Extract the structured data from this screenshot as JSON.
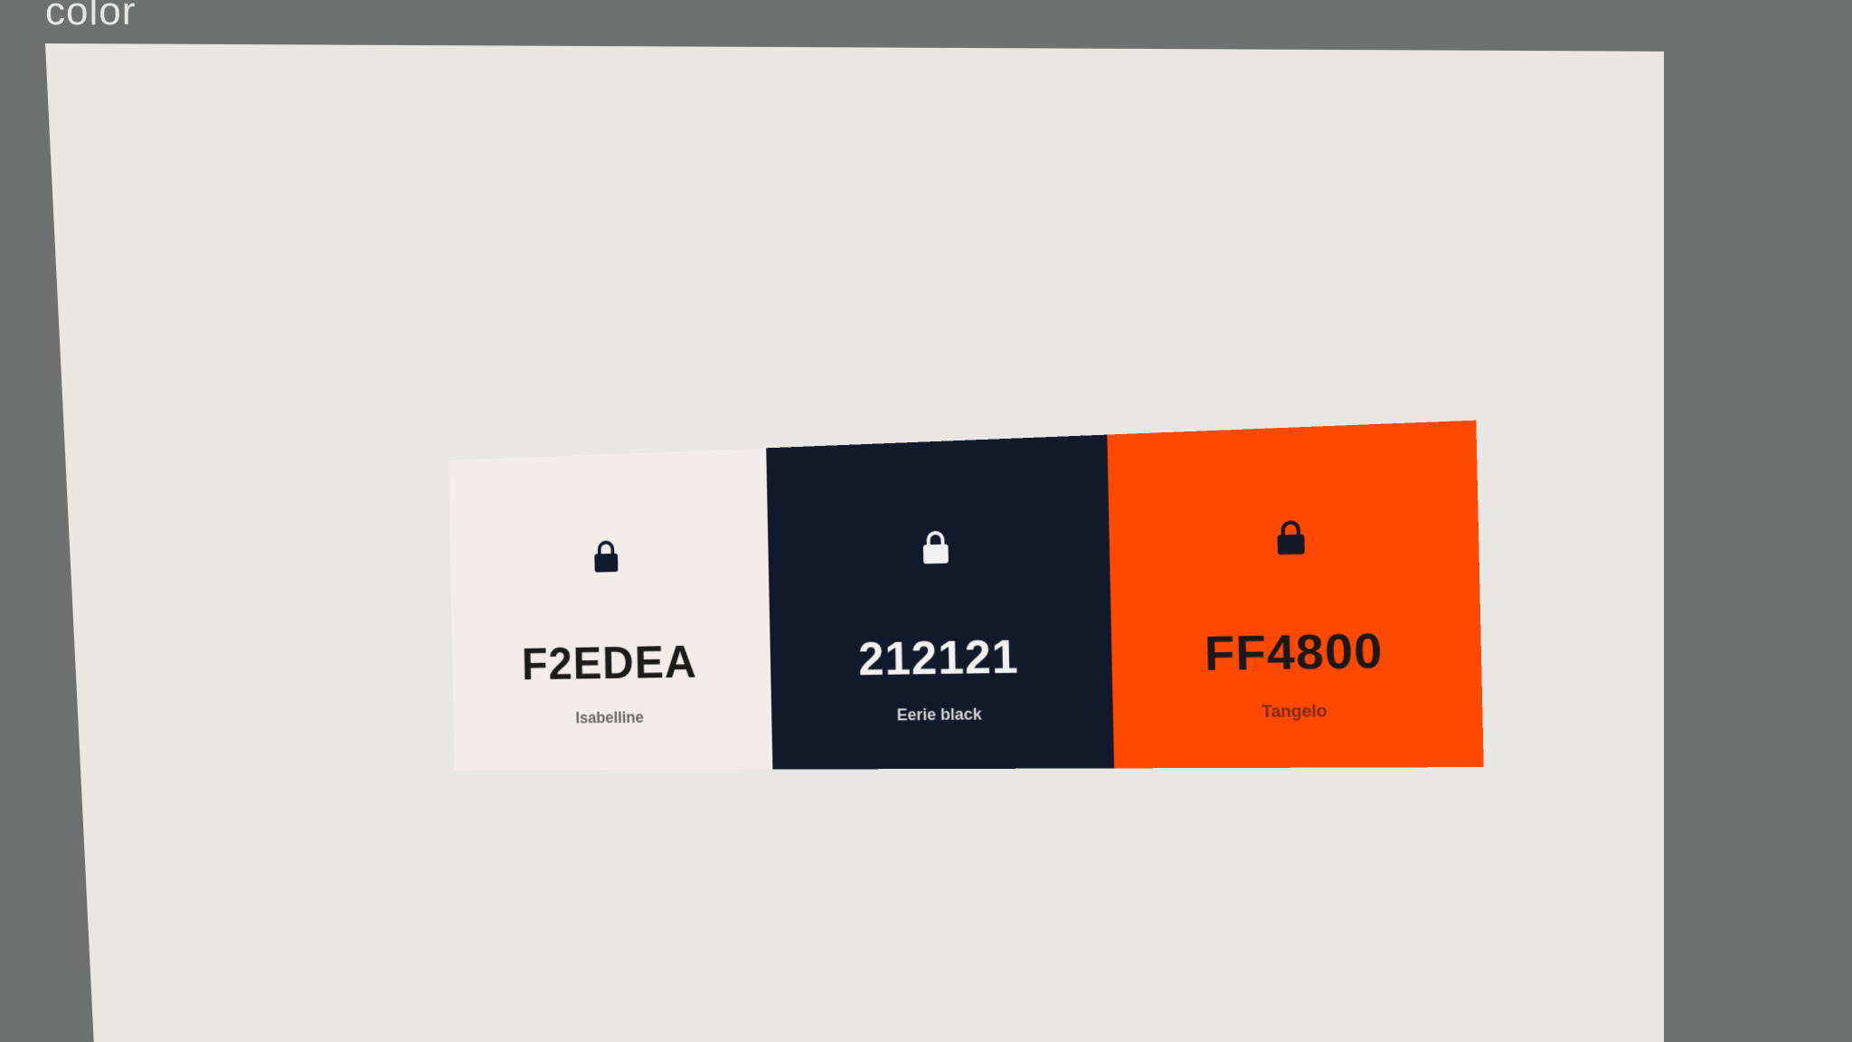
{
  "page": {
    "heading": "color"
  },
  "palette": {
    "colors": [
      {
        "hex": "F2EDEA",
        "name": "Isabelline",
        "swatch": "#F2EDEA",
        "text_color": "#1c1c1c",
        "name_color": "#6a6764",
        "lock_icon": "lock-icon",
        "lock_color": "#0f1a2a"
      },
      {
        "hex": "212121",
        "name": "Eerie black",
        "swatch": "#111a2b",
        "text_color": "#f2f2f2",
        "name_color": "#d4d4d4",
        "lock_icon": "lock-icon",
        "lock_color": "#f2f2f2"
      },
      {
        "hex": "FF4800",
        "name": "Tangelo",
        "swatch": "#FF4800",
        "text_color": "#1a1818",
        "name_color": "#7a2a10",
        "lock_icon": "lock-icon",
        "lock_color": "#121826"
      }
    ]
  }
}
